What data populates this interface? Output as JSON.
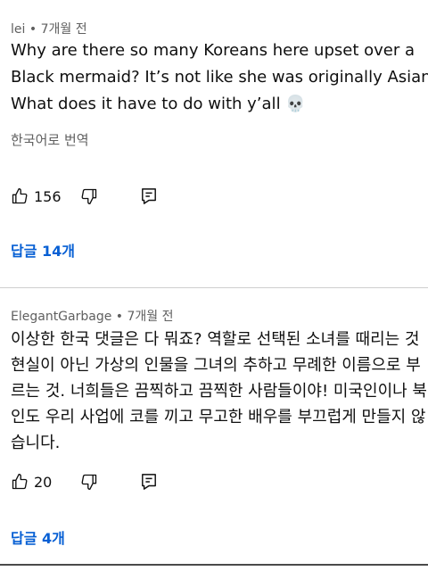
{
  "comments": [
    {
      "author": "lei",
      "time": "7개월 전",
      "lines": [
        "Why are there so many Koreans here upset over a",
        "Black mermaid? It’s not like she was originally Asian.",
        "What does it have to do with y’all 💀"
      ],
      "translate_label": "한국어로 번역",
      "likes": "156",
      "replies_label": "답글 14개"
    },
    {
      "author": "ElegantGarbage",
      "time": "7개월 전",
      "lines": [
        "이상한 한국 댓글은 다 뭐죠? 역할로 선택된 소녀를 때리는 것",
        "현실이 아닌 가상의 인물을 그녀의 추하고 무례한 이름으로 부",
        "르는 것. 너희들은 끔찍하고 끔찍한 사람들이야! 미국인이나 북",
        "인도 우리 사업에 코를 끼고 무고한 배우를 부끄럽게 만들지 않",
        "습니다."
      ],
      "likes": "20",
      "replies_label": "답글 4개"
    }
  ],
  "separator": "•",
  "colors": {
    "link": "#065fd4",
    "meta": "#606060",
    "text": "#0f0f0f"
  },
  "icons": [
    "thumbs-up-icon",
    "thumbs-down-icon",
    "reply-icon"
  ]
}
